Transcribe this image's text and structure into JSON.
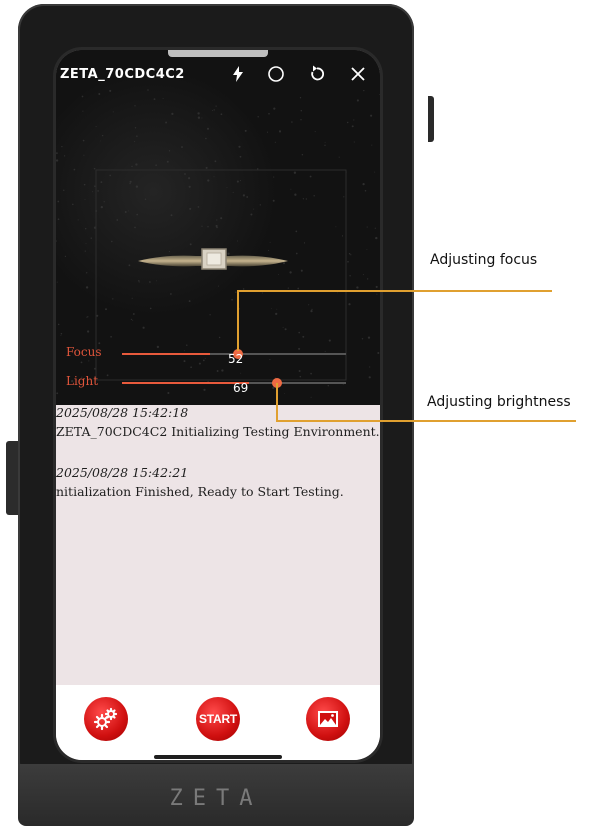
{
  "device": {
    "brand_mark": "ZETA"
  },
  "app": {
    "title": "ZETA_70CDC4C2",
    "toolbar": [
      {
        "name": "flash-icon"
      },
      {
        "name": "capture-circle-icon"
      },
      {
        "name": "refresh-icon"
      },
      {
        "name": "close-icon"
      }
    ]
  },
  "controls": {
    "focus": {
      "label": "Focus",
      "value": "52",
      "level": 52
    },
    "light": {
      "label": "Light",
      "value": "69",
      "level": 69
    }
  },
  "log": [
    {
      "time": "2025/08/28 15:42:18",
      "message": "ZETA_70CDC4C2 Initializing Testing Environment..."
    },
    {
      "time": "2025/08/28 15:42:21",
      "message": "nitialization Finished, Ready to Start Testing."
    }
  ],
  "bottom_bar": {
    "settings_icon": "gears-icon",
    "start_label": "START",
    "gallery_icon": "image-icon"
  },
  "annotations": {
    "focus_callout": "Adjusting focus",
    "brightness_callout": "Adjusting brightness",
    "line_color": "#e0a030"
  },
  "colors": {
    "accent": "#e85a3c",
    "button_red": "#d01010",
    "log_background": "#ede4e6"
  }
}
